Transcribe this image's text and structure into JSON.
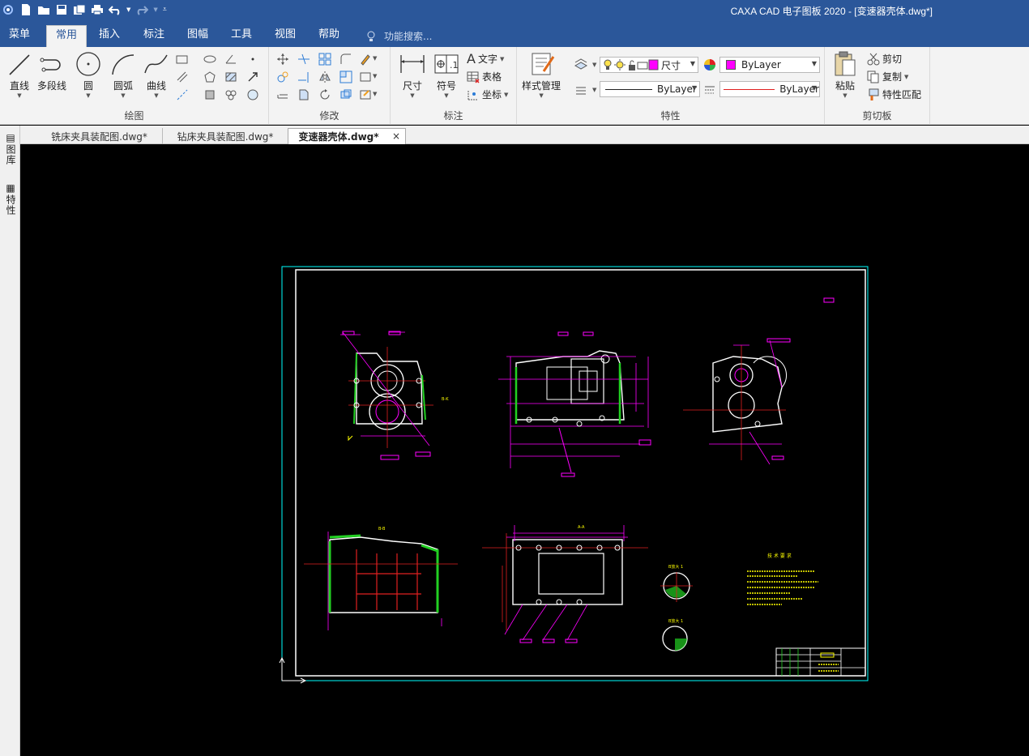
{
  "app": {
    "title": "CAXA CAD 电子图板 2020 - [变速器壳体.dwg*]"
  },
  "quick_access": {
    "icons": [
      "app-icon",
      "new-icon",
      "open-icon",
      "save-icon",
      "save-all-icon",
      "print-icon",
      "undo-icon",
      "redo-icon",
      "customize-icon"
    ]
  },
  "menu_tabs": [
    {
      "label": "菜单"
    },
    {
      "label": "常用"
    },
    {
      "label": "插入"
    },
    {
      "label": "标注"
    },
    {
      "label": "图幅"
    },
    {
      "label": "工具"
    },
    {
      "label": "视图"
    },
    {
      "label": "帮助"
    }
  ],
  "search": {
    "placeholder": "功能搜索..."
  },
  "ribbon": {
    "draw": {
      "label": "绘图",
      "line": "直线",
      "polyline": "多段线",
      "circle": "圆",
      "arc": "圆弧",
      "curve": "曲线"
    },
    "modify": {
      "label": "修改"
    },
    "annotate": {
      "label": "标注",
      "dimension": "尺寸",
      "symbol": "符号",
      "text": "文字",
      "table": "表格",
      "coordinate": "坐标"
    },
    "properties": {
      "label": "特性",
      "style_manager": "样式管理",
      "layer_value": "尺寸",
      "color_value": "ByLayer",
      "linetype_value": "ByLayer",
      "lineweight_value": "ByLayer",
      "color_accent": "#ff00ff",
      "line_color": "#e02020"
    },
    "clipboard": {
      "label": "剪切板",
      "paste": "粘贴",
      "cut": "剪切",
      "copy": "复制",
      "match": "特性匹配"
    }
  },
  "doc_tabs": [
    {
      "label": "铣床夹具装配图.dwg*"
    },
    {
      "label": "钻床夹具装配图.dwg*"
    },
    {
      "label": "变速器壳体.dwg*"
    }
  ],
  "side_panel": {
    "library": "图库",
    "properties": "特性"
  },
  "drawing": {
    "background": "#000000",
    "frame_color": "#00ffff",
    "view_label_1": "B-B",
    "view_label_2": "A-A",
    "detail_label_1": "B放大 1",
    "detail_label_2": "B放大 1",
    "tech_title": "技 术 要 求"
  }
}
